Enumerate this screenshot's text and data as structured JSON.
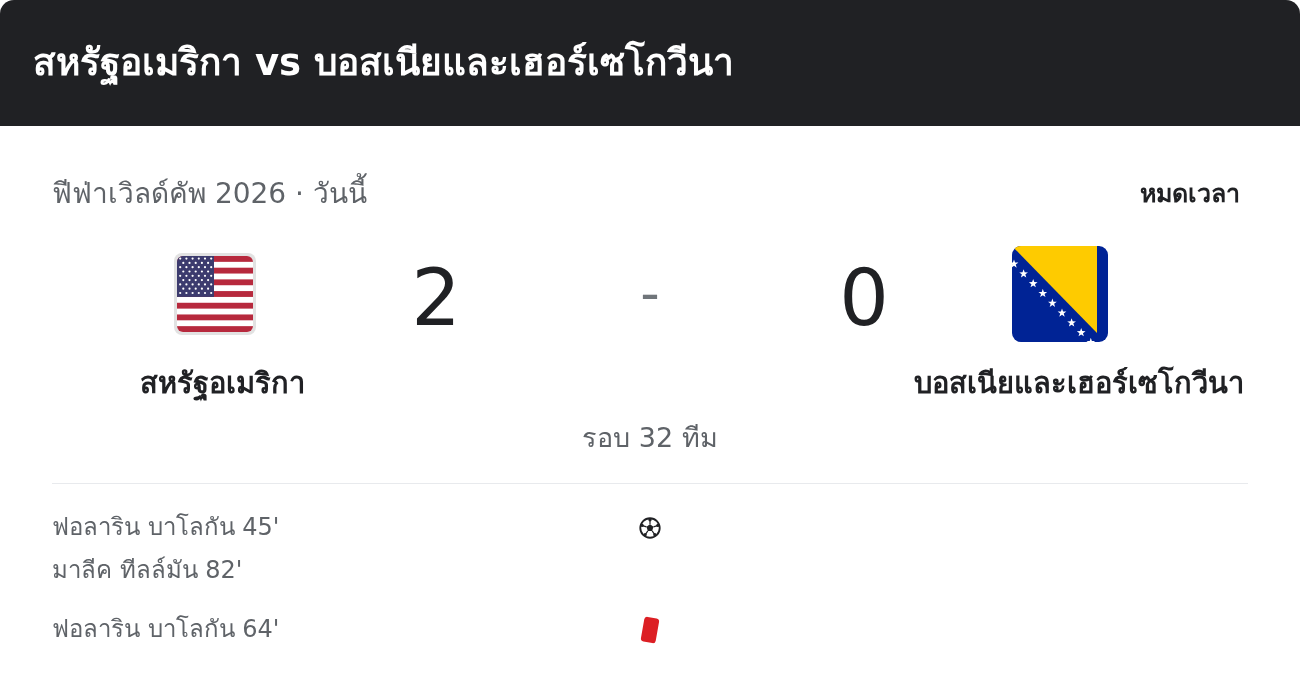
{
  "header": {
    "title": "สหรัฐอเมริกา vs บอสเนียและเฮอร์เซโกวีนา"
  },
  "match": {
    "competition": "ฟีฟ่าเวิลด์คัพ 2026 · วันนี้",
    "status": "หมดเวลา",
    "teams": [
      {
        "name": "สหรัฐอเมริกา",
        "score": "2"
      },
      {
        "name": "บอสเนียและเฮอร์เซโกวีนา",
        "score": "0"
      }
    ],
    "score_separator": "-",
    "stage": "รอบ 32 ทีม"
  },
  "events": [
    {
      "kind": "goal",
      "lines": [
        "ฟอลาริน บาโลกัน 45'",
        "มาลีค ทีลล์มัน 82'"
      ]
    },
    {
      "kind": "red_card",
      "lines": [
        "ฟอลาริน บาโลกัน 64'"
      ]
    }
  ]
}
